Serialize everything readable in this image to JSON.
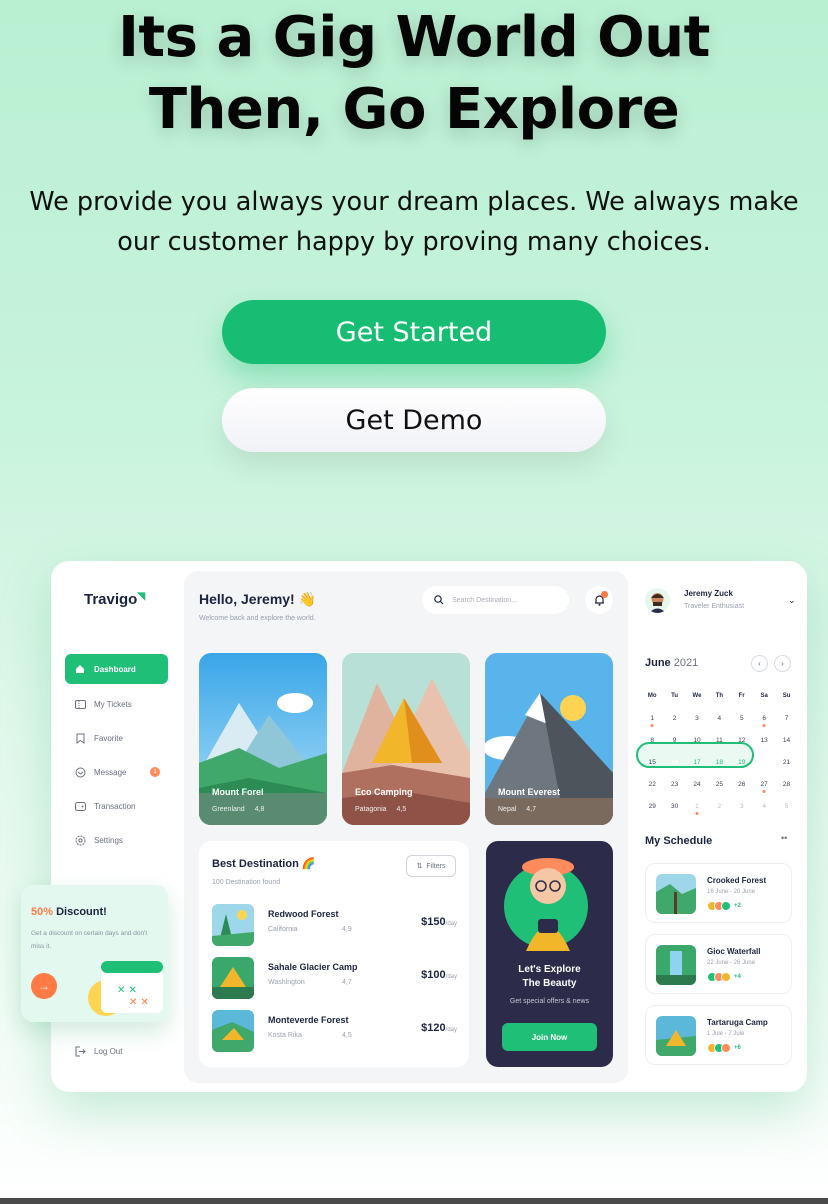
{
  "hero": {
    "title_line1": "Its a Gig World Out",
    "title_line2": "Then, Go Explore",
    "subtitle_line1": "We provide you always your dream places. We always make",
    "subtitle_line2": "our customer happy by proving many choices."
  },
  "buttons": {
    "primary": "Get Started",
    "secondary": "Get Demo"
  },
  "app": {
    "logo": "Travigo",
    "sidebar": {
      "items": [
        {
          "label": "Dashboard",
          "icon": "home-icon",
          "active": true
        },
        {
          "label": "My Tickets",
          "icon": "ticket-icon"
        },
        {
          "label": "Favorite",
          "icon": "bookmark-icon"
        },
        {
          "label": "Message",
          "icon": "message-icon",
          "badge": "1"
        },
        {
          "label": "Transaction",
          "icon": "wallet-icon"
        },
        {
          "label": "Settings",
          "icon": "gear-icon"
        }
      ],
      "logout": "Log Out"
    },
    "discount": {
      "percent": "50%",
      "label": "Discount!",
      "text": "Get a discount on certain days and don't miss it."
    },
    "header": {
      "greeting": "Hello, Jeremy! 👋",
      "welcome": "Welcome back and explore the world.",
      "search_placeholder": "Search Destination..."
    },
    "cards": [
      {
        "title": "Mount Forel",
        "location": "Greenland",
        "rating": "4,8"
      },
      {
        "title": "Eco Camping",
        "location": "Patagonia",
        "rating": "4,5"
      },
      {
        "title": "Mount Everest",
        "location": "Nepal",
        "rating": "4,7"
      }
    ],
    "best": {
      "title": "Best Destination 🌈",
      "subtitle": "100 Destination found",
      "filters": "Filters",
      "rows": [
        {
          "name": "Redwood Forest",
          "location": "California",
          "rating": "4,9",
          "price": "$150",
          "unit": "/day"
        },
        {
          "name": "Sahale Glacier Camp",
          "location": "Washington",
          "rating": "4,7",
          "price": "$100",
          "unit": "/day"
        },
        {
          "name": "Monteverde Forest",
          "location": "Kosta Rika",
          "rating": "4,5",
          "price": "$120",
          "unit": "/day"
        }
      ]
    },
    "promo": {
      "title_line1": "Let's Explore",
      "title_line2": "The Beauty",
      "subtitle": "Get special offers & news",
      "button": "Join Now"
    },
    "user": {
      "name": "Jeremy Zuck",
      "role": "Traveler Enthusiast"
    },
    "calendar": {
      "month": "June",
      "year": "2021",
      "weekdays": [
        "Mo",
        "Tu",
        "We",
        "Th",
        "Fr",
        "Sa",
        "Su"
      ],
      "weeks": [
        [
          "1",
          "2",
          "3",
          "4",
          "5",
          "6",
          "7"
        ],
        [
          "8",
          "9",
          "10",
          "11",
          "12",
          "13",
          "14"
        ],
        [
          "15",
          "16",
          "17",
          "18",
          "19",
          "20",
          "21"
        ],
        [
          "22",
          "23",
          "24",
          "25",
          "26",
          "27",
          "28"
        ],
        [
          "29",
          "30",
          "1",
          "2",
          "3",
          "4",
          "5"
        ]
      ]
    },
    "schedule": {
      "title": "My Schedule",
      "items": [
        {
          "name": "Crooked Forest",
          "date": "16 June - 20 June",
          "more": "+2"
        },
        {
          "name": "Gioc Waterfall",
          "date": "22 June - 26 June",
          "more": "+4"
        },
        {
          "name": "Tartaruga Camp",
          "date": "1 Jule - 7 Jule",
          "more": "+6"
        }
      ]
    }
  },
  "colors": {
    "accent": "#1fbf78",
    "primary_button": "#17bd72",
    "orange": "#ff7a45",
    "navy": "#1c2340"
  }
}
